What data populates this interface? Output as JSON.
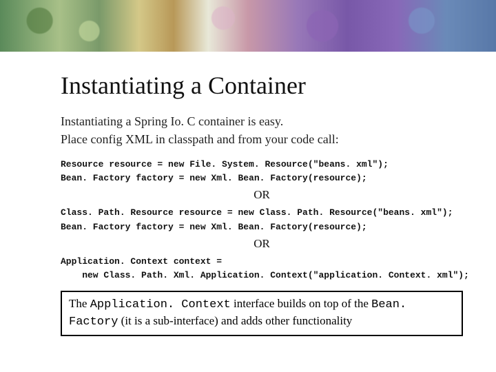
{
  "title": "Instantiating a Container",
  "desc_line1": "Instantiating a Spring Io. C container is easy.",
  "desc_line2": "Place config XML in classpath and from your code call:",
  "code1a": "Resource resource = new File. System. Resource(\"beans. xml\");",
  "code1b": "Bean. Factory factory = new Xml. Bean. Factory(resource);",
  "or": "OR",
  "code2a": "Class. Path. Resource resource = new Class. Path. Resource(\"beans. xml\");",
  "code2b": "Bean. Factory factory = new Xml. Bean. Factory(resource);",
  "code3a": "Application. Context context =",
  "code3b": "    new Class. Path. Xml. Application. Context(\"application. Context. xml\");",
  "note_pre": "The ",
  "note_mono1": "Application. Context",
  "note_mid1": " interface builds on top of the ",
  "note_mono2": "Bean. Factory",
  "note_post": " (it is a sub-interface) and adds other functionality"
}
